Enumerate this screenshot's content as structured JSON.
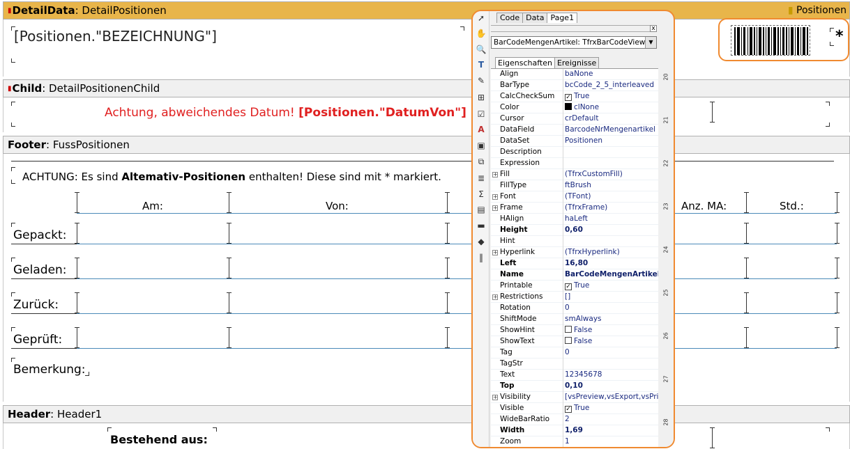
{
  "bands": {
    "detaildata": {
      "kind": "DetailData",
      "name": ": DetailPositionen",
      "right_label": "Positionen",
      "field": "[Positionen.\"BEZEICHNUNG\"]",
      "asterisk": "*"
    },
    "child": {
      "kind": "Child",
      "name": ": DetailPositionenChild",
      "warn_text": "Achtung, abweichendes Datum! ",
      "warn_field": "[Positionen.\"DatumVon\"]"
    },
    "footer": {
      "kind": "Footer",
      "name": ": FussPositionen",
      "note_pre": "ACHTUNG: Es sind ",
      "note_bold": "Altemativ-Positionen",
      "note_post": " enthalten! Diese sind mit * markiert.",
      "col_am": "Am:",
      "col_von": "Von:",
      "col_anzma": "Anz. MA:",
      "col_std": "Std.:",
      "rows": [
        "Gepackt:",
        "Geladen:",
        "Zurück:",
        "Geprüft:"
      ],
      "bemerkung": "Bemerkung:"
    },
    "header": {
      "kind": "Header",
      "name": ": Header1",
      "bestehend": "Bestehend aus:"
    }
  },
  "inspector": {
    "tabs": [
      "Code",
      "Data",
      "Page1"
    ],
    "object": "BarCodeMengenArtikel: TfrxBarCodeView",
    "subtabs": [
      "Eigenschaften",
      "Ereignisse"
    ],
    "close": "x",
    "properties": [
      {
        "name": "Align",
        "value": "baNone"
      },
      {
        "name": "BarType",
        "value": "bcCode_2_5_interleaved"
      },
      {
        "name": "CalcCheckSum",
        "value": "True",
        "check": true
      },
      {
        "name": "Color",
        "value": "clNone",
        "swatch": "#000000"
      },
      {
        "name": "Cursor",
        "value": "crDefault"
      },
      {
        "name": "DataField",
        "value": "BarcodeNrMengenartikel"
      },
      {
        "name": "DataSet",
        "value": "Positionen"
      },
      {
        "name": "Description",
        "value": ""
      },
      {
        "name": "Expression",
        "value": ""
      },
      {
        "name": "Fill",
        "value": "(TfrxCustomFill)",
        "expand": true
      },
      {
        "name": "FillType",
        "value": "ftBrush"
      },
      {
        "name": "Font",
        "value": "(TFont)",
        "expand": true
      },
      {
        "name": "Frame",
        "value": "(TfrxFrame)",
        "expand": true
      },
      {
        "name": "HAlign",
        "value": "haLeft"
      },
      {
        "name": "Height",
        "value": "0,60",
        "bold": true
      },
      {
        "name": "Hint",
        "value": ""
      },
      {
        "name": "Hyperlink",
        "value": "(TfrxHyperlink)",
        "expand": true
      },
      {
        "name": "Left",
        "value": "16,80",
        "bold": true
      },
      {
        "name": "Name",
        "value": "BarCodeMengenArtikel",
        "bold": true
      },
      {
        "name": "Printable",
        "value": "True",
        "check": true
      },
      {
        "name": "Restrictions",
        "value": "[]",
        "expand": true
      },
      {
        "name": "Rotation",
        "value": "0"
      },
      {
        "name": "ShiftMode",
        "value": "smAlways"
      },
      {
        "name": "ShowHint",
        "value": "False",
        "check": false
      },
      {
        "name": "ShowText",
        "value": "False",
        "check": false
      },
      {
        "name": "Tag",
        "value": "0"
      },
      {
        "name": "TagStr",
        "value": ""
      },
      {
        "name": "Text",
        "value": "12345678"
      },
      {
        "name": "Top",
        "value": "0,10",
        "bold": true
      },
      {
        "name": "Visibility",
        "value": "[vsPreview,vsExport,vsPrin",
        "expand": true
      },
      {
        "name": "Visible",
        "value": "True",
        "check": true
      },
      {
        "name": "WideBarRatio",
        "value": "2"
      },
      {
        "name": "Width",
        "value": "1,69",
        "bold": true
      },
      {
        "name": "Zoom",
        "value": "1"
      }
    ],
    "ruler": [
      "20",
      "21",
      "22",
      "23",
      "24",
      "25",
      "26",
      "27",
      "28"
    ]
  },
  "colors": {
    "accent": "#f08a30",
    "band_header": "#e8b54a",
    "band_gray": "#f0f0f0",
    "warn": "#e02020",
    "line": "#4a8ab8"
  }
}
